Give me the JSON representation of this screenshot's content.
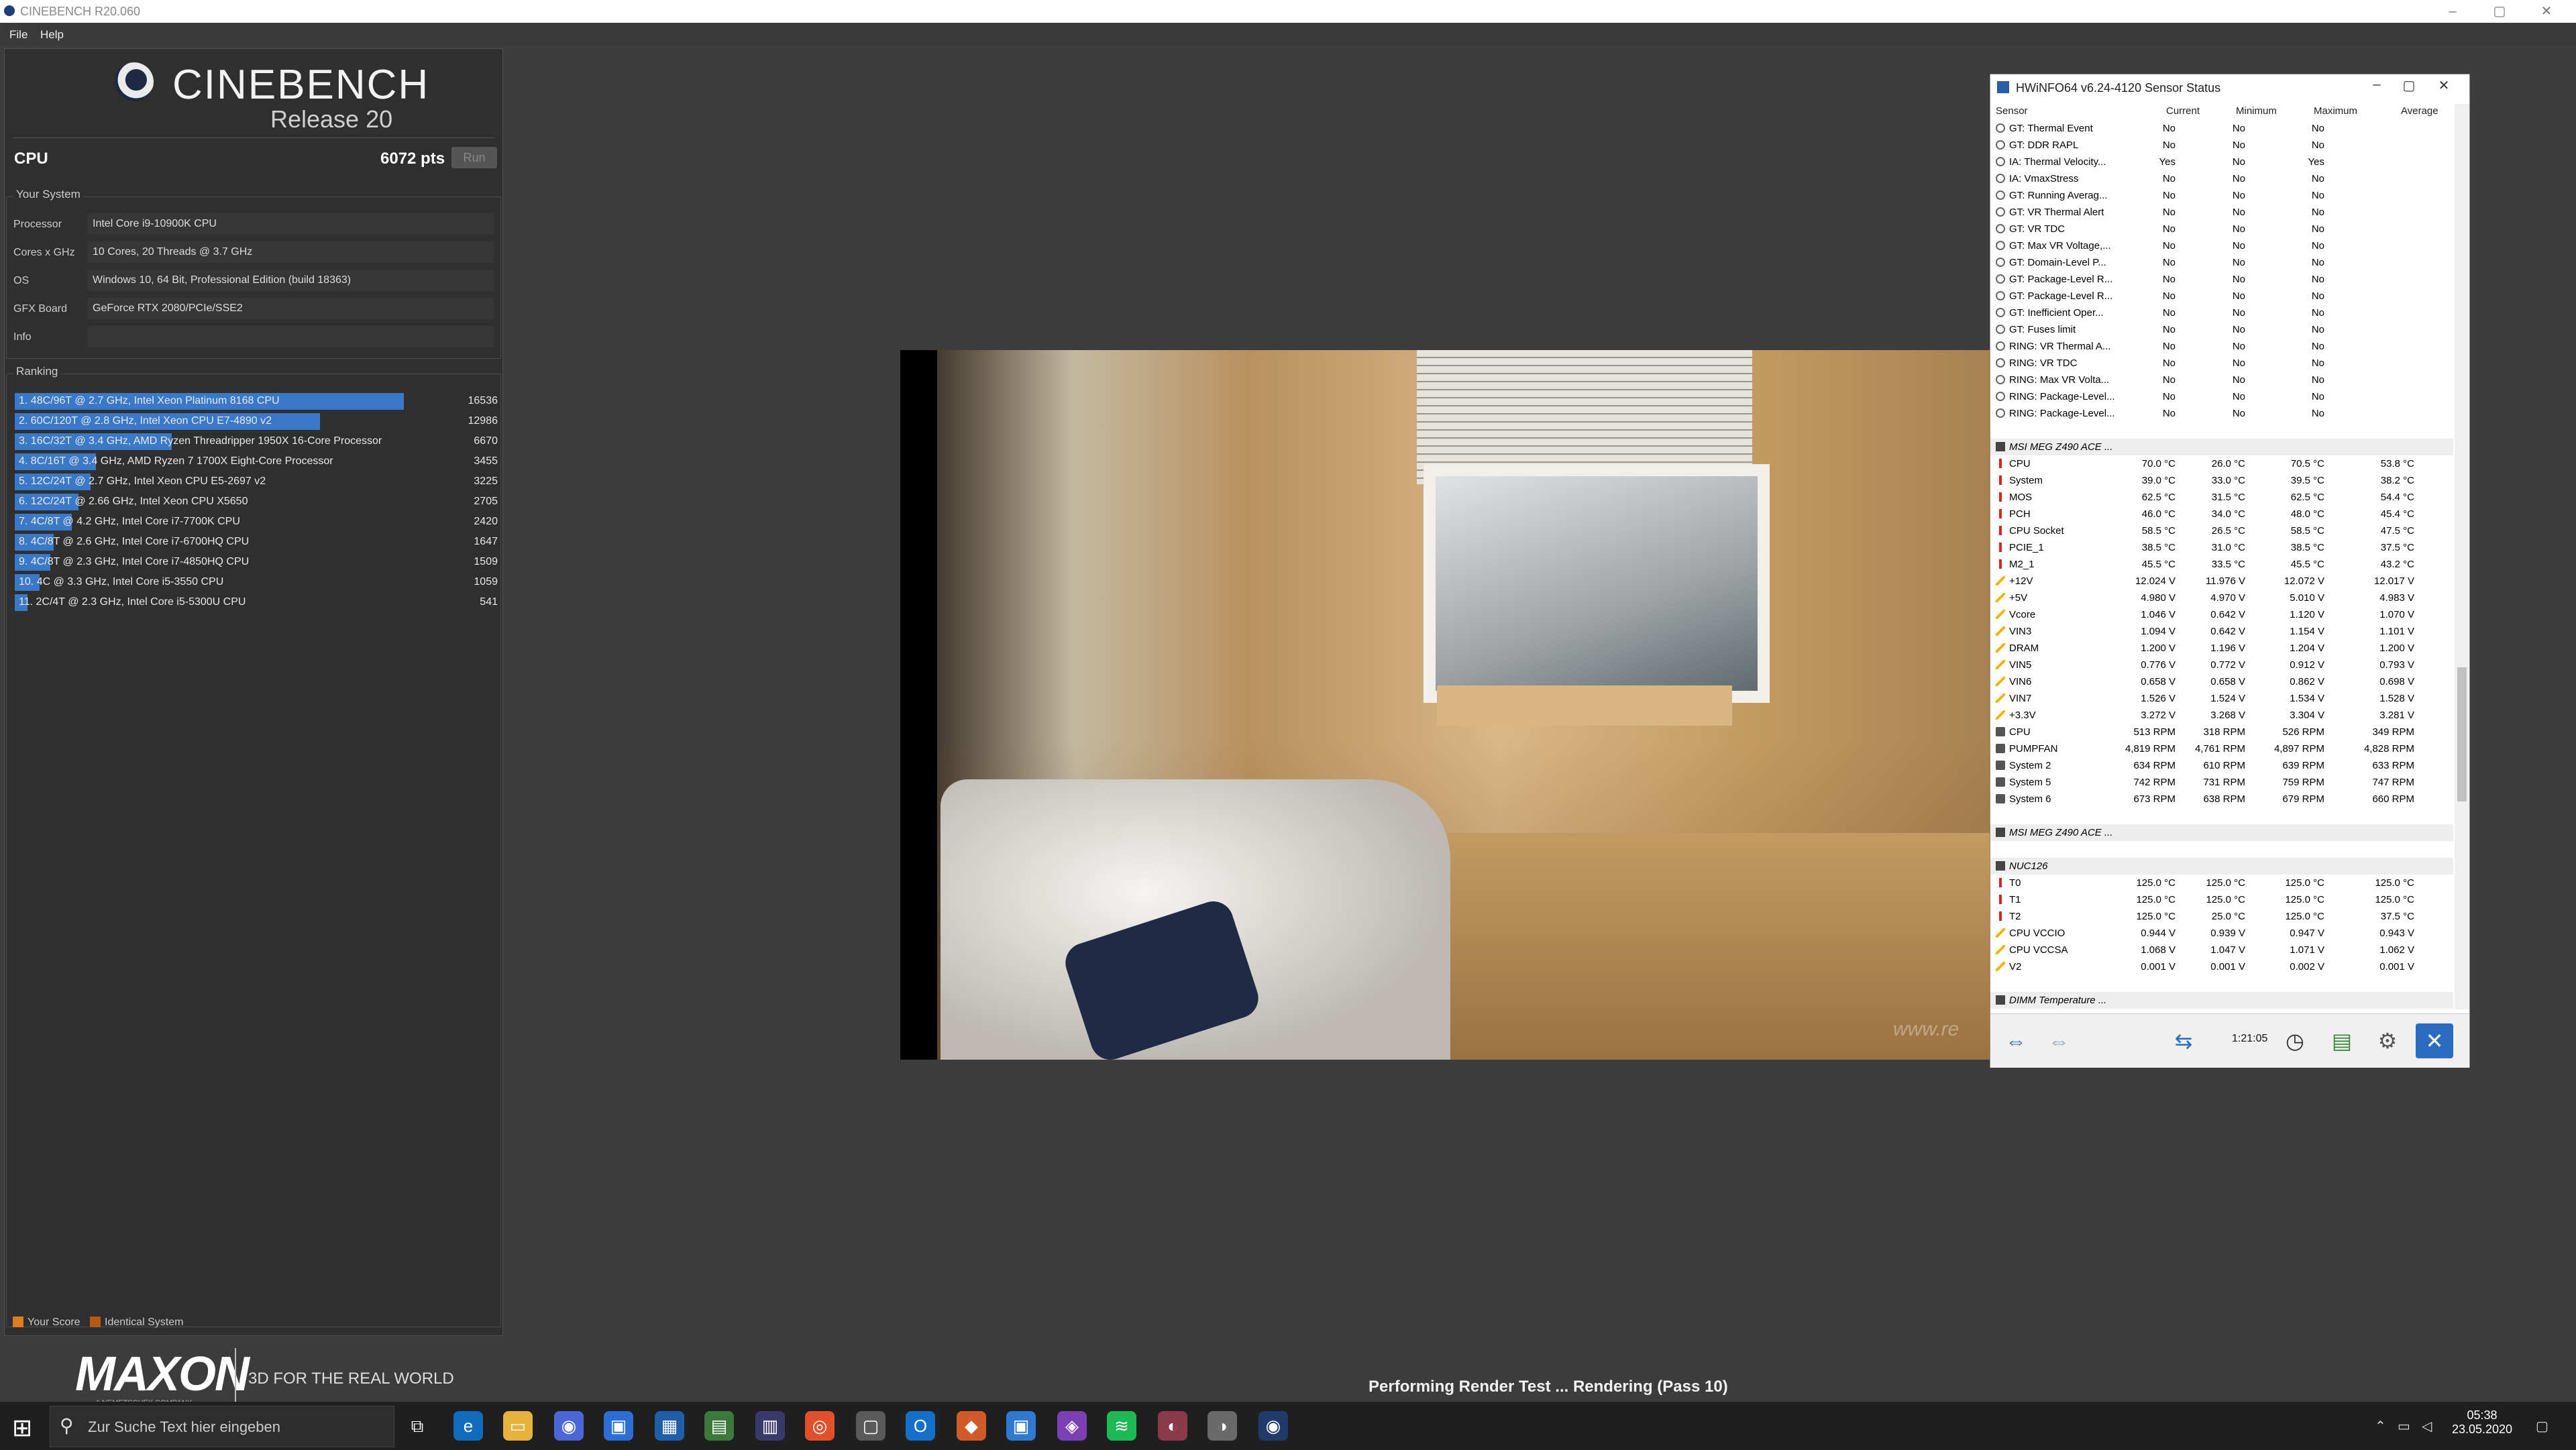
{
  "window": {
    "title": "CINEBENCH R20.060",
    "menu": [
      "File",
      "Help"
    ]
  },
  "cinebench": {
    "logo": "CINEBENCH",
    "release": "Release 20",
    "cpu_label": "CPU",
    "cpu_score": "6072 pts",
    "run_label": "Run",
    "your_system_title": "Your System",
    "system": [
      {
        "key": "Processor",
        "value": "Intel Core i9-10900K CPU"
      },
      {
        "key": "Cores x GHz",
        "value": "10 Cores, 20 Threads @ 3.7 GHz"
      },
      {
        "key": "OS",
        "value": "Windows 10, 64 Bit, Professional Edition (build 18363)"
      },
      {
        "key": "GFX Board",
        "value": "GeForce RTX 2080/PCIe/SSE2"
      },
      {
        "key": "Info",
        "value": ""
      }
    ],
    "ranking_title": "Ranking",
    "ranking": [
      {
        "label": "1. 48C/96T @ 2.7 GHz, Intel Xeon Platinum 8168 CPU",
        "score": "16536",
        "fraction": 1.0
      },
      {
        "label": "2. 60C/120T @ 2.8 GHz, Intel Xeon CPU E7-4890 v2",
        "score": "12986",
        "fraction": 0.785
      },
      {
        "label": "3. 16C/32T @ 3.4 GHz, AMD Ryzen Threadripper 1950X 16-Core Processor",
        "score": "6670",
        "fraction": 0.403
      },
      {
        "label": "4. 8C/16T @ 3.4 GHz, AMD Ryzen 7 1700X Eight-Core Processor",
        "score": "3455",
        "fraction": 0.209
      },
      {
        "label": "5. 12C/24T @ 2.7 GHz, Intel Xeon CPU E5-2697 v2",
        "score": "3225",
        "fraction": 0.195
      },
      {
        "label": "6. 12C/24T @ 2.66 GHz, Intel Xeon CPU X5650",
        "score": "2705",
        "fraction": 0.164
      },
      {
        "label": "7. 4C/8T @ 4.2 GHz, Intel Core i7-7700K CPU",
        "score": "2420",
        "fraction": 0.146
      },
      {
        "label": "8. 4C/8T @ 2.6 GHz, Intel Core i7-6700HQ CPU",
        "score": "1647",
        "fraction": 0.1
      },
      {
        "label": "9. 4C/8T @ 2.3 GHz, Intel Core i7-4850HQ CPU",
        "score": "1509",
        "fraction": 0.091
      },
      {
        "label": "10. 4C @ 3.3 GHz, Intel Core i5-3550 CPU",
        "score": "1059",
        "fraction": 0.064
      },
      {
        "label": "11. 2C/4T @ 2.3 GHz, Intel Core i5-5300U CPU",
        "score": "541",
        "fraction": 0.033
      }
    ],
    "legend": {
      "your_score": "Your Score",
      "identical": "Identical System"
    },
    "maxon": {
      "logo": "MAXON",
      "sub": "A NEMETSCHEK COMPANY",
      "tagline": "3D FOR THE REAL WORLD"
    },
    "status": "Performing Render Test ... Rendering (Pass 10)",
    "render_watermark": "www.re"
  },
  "colors": {
    "rank_bar": "#3a79c7",
    "your_score": "#e07b1f",
    "identical": "#b25a16"
  },
  "hwinfo": {
    "title": "HWiNFO64 v6.24-4120 Sensor Status",
    "columns": [
      "Sensor",
      "Current",
      "Minimum",
      "Maximum",
      "Average"
    ],
    "rows": [
      {
        "type": "row",
        "icon": "circle",
        "name": "GT: Thermal Event",
        "cur": "No",
        "min": "No",
        "max": "No",
        "avg": ""
      },
      {
        "type": "row",
        "icon": "circle",
        "name": "GT: DDR RAPL",
        "cur": "No",
        "min": "No",
        "max": "No",
        "avg": ""
      },
      {
        "type": "row",
        "icon": "circle",
        "name": "IA: Thermal Velocity...",
        "cur": "Yes",
        "min": "No",
        "max": "Yes",
        "avg": ""
      },
      {
        "type": "row",
        "icon": "circle",
        "name": "IA: VmaxStress",
        "cur": "No",
        "min": "No",
        "max": "No",
        "avg": ""
      },
      {
        "type": "row",
        "icon": "circle",
        "name": "GT: Running Averag...",
        "cur": "No",
        "min": "No",
        "max": "No",
        "avg": ""
      },
      {
        "type": "row",
        "icon": "circle",
        "name": "GT: VR Thermal Alert",
        "cur": "No",
        "min": "No",
        "max": "No",
        "avg": ""
      },
      {
        "type": "row",
        "icon": "circle",
        "name": "GT: VR TDC",
        "cur": "No",
        "min": "No",
        "max": "No",
        "avg": ""
      },
      {
        "type": "row",
        "icon": "circle",
        "name": "GT: Max VR Voltage,...",
        "cur": "No",
        "min": "No",
        "max": "No",
        "avg": ""
      },
      {
        "type": "row",
        "icon": "circle",
        "name": "GT: Domain-Level P...",
        "cur": "No",
        "min": "No",
        "max": "No",
        "avg": ""
      },
      {
        "type": "row",
        "icon": "circle",
        "name": "GT: Package-Level R...",
        "cur": "No",
        "min": "No",
        "max": "No",
        "avg": ""
      },
      {
        "type": "row",
        "icon": "circle",
        "name": "GT: Package-Level R...",
        "cur": "No",
        "min": "No",
        "max": "No",
        "avg": ""
      },
      {
        "type": "row",
        "icon": "circle",
        "name": "GT: Inefficient Oper...",
        "cur": "No",
        "min": "No",
        "max": "No",
        "avg": ""
      },
      {
        "type": "row",
        "icon": "circle",
        "name": "GT: Fuses limit",
        "cur": "No",
        "min": "No",
        "max": "No",
        "avg": ""
      },
      {
        "type": "row",
        "icon": "circle",
        "name": "RING: VR Thermal A...",
        "cur": "No",
        "min": "No",
        "max": "No",
        "avg": ""
      },
      {
        "type": "row",
        "icon": "circle",
        "name": "RING: VR TDC",
        "cur": "No",
        "min": "No",
        "max": "No",
        "avg": ""
      },
      {
        "type": "row",
        "icon": "circle",
        "name": "RING: Max VR Volta...",
        "cur": "No",
        "min": "No",
        "max": "No",
        "avg": ""
      },
      {
        "type": "row",
        "icon": "circle",
        "name": "RING: Package-Level...",
        "cur": "No",
        "min": "No",
        "max": "No",
        "avg": ""
      },
      {
        "type": "row",
        "icon": "circle",
        "name": "RING: Package-Level...",
        "cur": "No",
        "min": "No",
        "max": "No",
        "avg": ""
      },
      {
        "type": "gap"
      },
      {
        "type": "group",
        "name": "MSI MEG Z490 ACE ..."
      },
      {
        "type": "row",
        "icon": "temp",
        "name": "CPU",
        "cur": "70.0 °C",
        "min": "26.0 °C",
        "max": "70.5 °C",
        "avg": "53.8 °C"
      },
      {
        "type": "row",
        "icon": "temp",
        "name": "System",
        "cur": "39.0 °C",
        "min": "33.0 °C",
        "max": "39.5 °C",
        "avg": "38.2 °C"
      },
      {
        "type": "row",
        "icon": "temp",
        "name": "MOS",
        "cur": "62.5 °C",
        "min": "31.5 °C",
        "max": "62.5 °C",
        "avg": "54.4 °C"
      },
      {
        "type": "row",
        "icon": "temp",
        "name": "PCH",
        "cur": "46.0 °C",
        "min": "34.0 °C",
        "max": "48.0 °C",
        "avg": "45.4 °C"
      },
      {
        "type": "row",
        "icon": "temp",
        "name": "CPU Socket",
        "cur": "58.5 °C",
        "min": "26.5 °C",
        "max": "58.5 °C",
        "avg": "47.5 °C"
      },
      {
        "type": "row",
        "icon": "temp",
        "name": "PCIE_1",
        "cur": "38.5 °C",
        "min": "31.0 °C",
        "max": "38.5 °C",
        "avg": "37.5 °C"
      },
      {
        "type": "row",
        "icon": "temp",
        "name": "M2_1",
        "cur": "45.5 °C",
        "min": "33.5 °C",
        "max": "45.5 °C",
        "avg": "43.2 °C"
      },
      {
        "type": "row",
        "icon": "volt",
        "name": "+12V",
        "cur": "12.024 V",
        "min": "11.976 V",
        "max": "12.072 V",
        "avg": "12.017 V"
      },
      {
        "type": "row",
        "icon": "volt",
        "name": "+5V",
        "cur": "4.980 V",
        "min": "4.970 V",
        "max": "5.010 V",
        "avg": "4.983 V"
      },
      {
        "type": "row",
        "icon": "volt",
        "name": "Vcore",
        "cur": "1.046 V",
        "min": "0.642 V",
        "max": "1.120 V",
        "avg": "1.070 V"
      },
      {
        "type": "row",
        "icon": "volt",
        "name": "VIN3",
        "cur": "1.094 V",
        "min": "0.642 V",
        "max": "1.154 V",
        "avg": "1.101 V"
      },
      {
        "type": "row",
        "icon": "volt",
        "name": "DRAM",
        "cur": "1.200 V",
        "min": "1.196 V",
        "max": "1.204 V",
        "avg": "1.200 V"
      },
      {
        "type": "row",
        "icon": "volt",
        "name": "VIN5",
        "cur": "0.776 V",
        "min": "0.772 V",
        "max": "0.912 V",
        "avg": "0.793 V"
      },
      {
        "type": "row",
        "icon": "volt",
        "name": "VIN6",
        "cur": "0.658 V",
        "min": "0.658 V",
        "max": "0.862 V",
        "avg": "0.698 V"
      },
      {
        "type": "row",
        "icon": "volt",
        "name": "VIN7",
        "cur": "1.526 V",
        "min": "1.524 V",
        "max": "1.534 V",
        "avg": "1.528 V"
      },
      {
        "type": "row",
        "icon": "volt",
        "name": "+3.3V",
        "cur": "3.272 V",
        "min": "3.268 V",
        "max": "3.304 V",
        "avg": "3.281 V"
      },
      {
        "type": "row",
        "icon": "fan",
        "name": "CPU",
        "cur": "513 RPM",
        "min": "318 RPM",
        "max": "526 RPM",
        "avg": "349 RPM"
      },
      {
        "type": "row",
        "icon": "fan",
        "name": "PUMPFAN",
        "cur": "4,819 RPM",
        "min": "4,761 RPM",
        "max": "4,897 RPM",
        "avg": "4,828 RPM"
      },
      {
        "type": "row",
        "icon": "fan",
        "name": "System 2",
        "cur": "634 RPM",
        "min": "610 RPM",
        "max": "639 RPM",
        "avg": "633 RPM"
      },
      {
        "type": "row",
        "icon": "fan",
        "name": "System 5",
        "cur": "742 RPM",
        "min": "731 RPM",
        "max": "759 RPM",
        "avg": "747 RPM"
      },
      {
        "type": "row",
        "icon": "fan",
        "name": "System 6",
        "cur": "673 RPM",
        "min": "638 RPM",
        "max": "679 RPM",
        "avg": "660 RPM"
      },
      {
        "type": "gap"
      },
      {
        "type": "group",
        "name": "MSI MEG Z490 ACE ..."
      },
      {
        "type": "gap"
      },
      {
        "type": "group",
        "name": "NUC126"
      },
      {
        "type": "row",
        "icon": "temp",
        "name": "T0",
        "cur": "125.0 °C",
        "min": "125.0 °C",
        "max": "125.0 °C",
        "avg": "125.0 °C"
      },
      {
        "type": "row",
        "icon": "temp",
        "name": "T1",
        "cur": "125.0 °C",
        "min": "125.0 °C",
        "max": "125.0 °C",
        "avg": "125.0 °C"
      },
      {
        "type": "row",
        "icon": "temp",
        "name": "T2",
        "cur": "125.0 °C",
        "min": "25.0 °C",
        "max": "125.0 °C",
        "avg": "37.5 °C"
      },
      {
        "type": "row",
        "icon": "volt",
        "name": "CPU VCCIO",
        "cur": "0.944 V",
        "min": "0.939 V",
        "max": "0.947 V",
        "avg": "0.943 V"
      },
      {
        "type": "row",
        "icon": "volt",
        "name": "CPU VCCSA",
        "cur": "1.068 V",
        "min": "1.047 V",
        "max": "1.071 V",
        "avg": "1.062 V"
      },
      {
        "type": "row",
        "icon": "volt",
        "name": "V2",
        "cur": "0.001 V",
        "min": "0.001 V",
        "max": "0.002 V",
        "avg": "0.001 V"
      },
      {
        "type": "gap"
      },
      {
        "type": "group",
        "name": "DIMM Temperature ..."
      }
    ],
    "elapsed": "1:21:05"
  },
  "taskbar": {
    "search_placeholder": "Zur Suche Text hier eingeben",
    "time": "05:38",
    "date": "23.05.2020"
  }
}
